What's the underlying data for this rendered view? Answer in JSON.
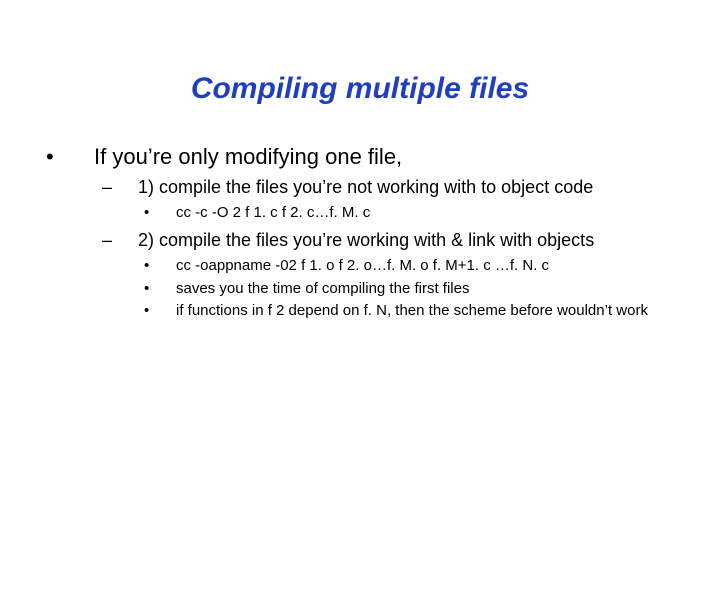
{
  "title": "Compiling multiple files",
  "items": [
    {
      "text": "If you’re only modifying one file,",
      "children": [
        {
          "text": "1) compile the files you’re not working with to object code",
          "children": [
            {
              "text": "cc -c -O 2 f 1. c f 2. c…f. M. c"
            }
          ]
        },
        {
          "text": "2) compile the files you’re working with & link with objects",
          "children": [
            {
              "text": "cc -oappname -02 f 1. o f 2. o…f. M. o f. M+1. c …f. N. c"
            },
            {
              "text": "saves you the time of compiling the first files"
            },
            {
              "text": "if functions in f 2 depend on f. N, then the scheme before wouldn’t work"
            }
          ]
        }
      ]
    }
  ]
}
